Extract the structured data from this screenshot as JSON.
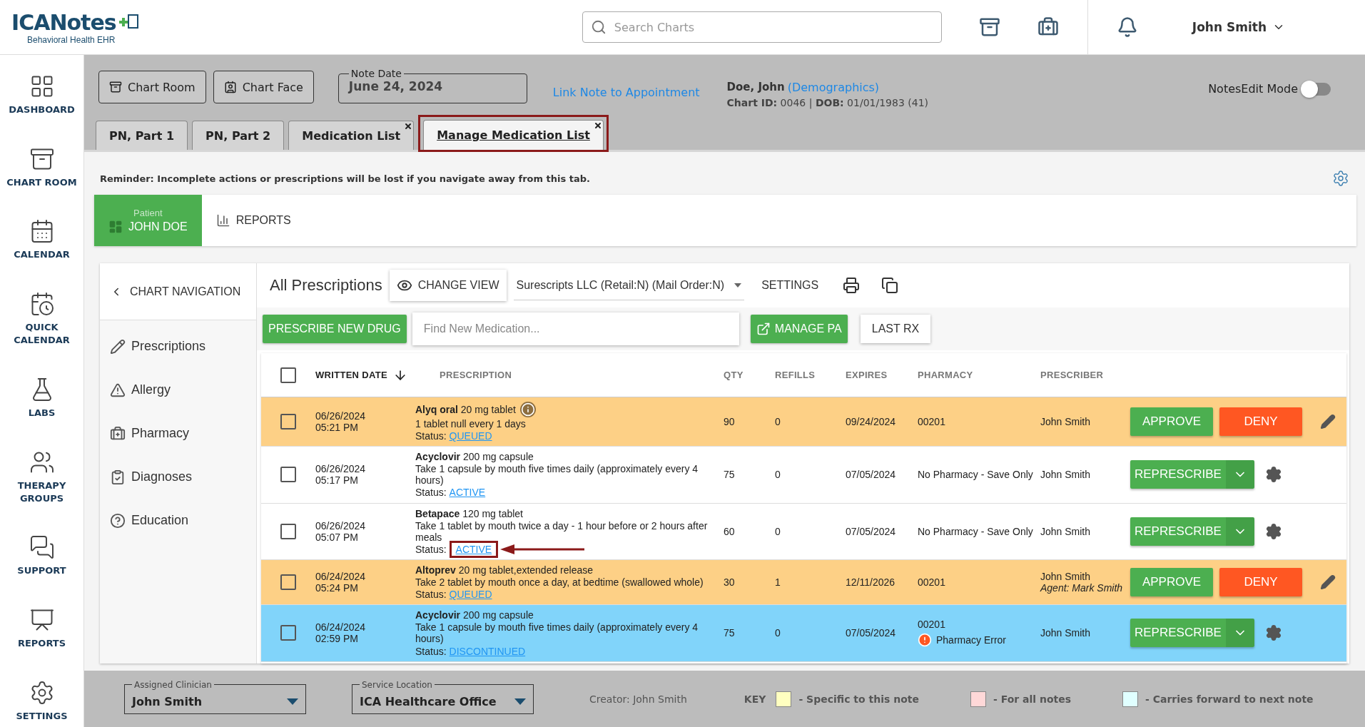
{
  "header": {
    "logo": {
      "name": "ICANotes",
      "tagline": "Behavioral Health EHR"
    },
    "search": {
      "placeholder": "Search Charts"
    },
    "user": "John Smith"
  },
  "sidebar": {
    "items": [
      {
        "label": "DASHBOARD"
      },
      {
        "label": "CHART ROOM"
      },
      {
        "label": "CALENDAR"
      },
      {
        "label": "QUICK CALENDAR"
      },
      {
        "label": "LABS"
      },
      {
        "label": "THERAPY GROUPS"
      },
      {
        "label": "SUPPORT"
      },
      {
        "label": "REPORTS"
      },
      {
        "label": "SETTINGS"
      }
    ]
  },
  "toolbar": {
    "buttons": [
      {
        "label": "Chart Room"
      },
      {
        "label": "Chart Face"
      }
    ],
    "note_date": {
      "label": "Note Date",
      "value": "June 24, 2024"
    },
    "link": "Link Note to Appointment",
    "patient": {
      "name": "Doe, John",
      "demographics": "(Demographics)",
      "details": "**Chart ID:** 0046 | **DOB:** 01/01/1983 (41)"
    },
    "edit_mode": {
      "label": "NotesEdit Mode",
      "on": false
    }
  },
  "tabs": [
    {
      "label": "PN, Part 1",
      "selected": false,
      "closable": false
    },
    {
      "label": "PN, Part 2",
      "selected": false,
      "closable": false
    },
    {
      "label": "Medication List",
      "selected": false,
      "closable": true
    },
    {
      "label": "Manage Medication List",
      "selected": true,
      "closable": true,
      "highlighted": true
    }
  ],
  "reminder": "Reminder: Incomplete actions or prescriptions will be lost if you navigate away from this tab.",
  "patient_bar": {
    "tabs": [
      {
        "caption": "Patient",
        "label": "JOHN DOE",
        "selected": true
      },
      {
        "label": "REPORTS",
        "selected": false
      }
    ]
  },
  "chart_navigation": {
    "title": "CHART NAVIGATION",
    "items": [
      {
        "label": "Prescriptions"
      },
      {
        "label": "Allergy"
      },
      {
        "label": "Pharmacy"
      },
      {
        "label": "Diagnoses"
      },
      {
        "label": "Education"
      }
    ]
  },
  "prescriptions": {
    "title": "All Prescriptions",
    "change_view": "CHANGE VIEW",
    "pharmacy_select": "Surescripts LLC (Retail:N) (Mail Order:N)",
    "settings": "SETTINGS",
    "prescribe_button": "PRESCRIBE NEW DRUG",
    "find": {
      "placeholder": "Find New Medication..."
    },
    "manage_pa": "MANAGE PA",
    "last_rx": "LAST RX",
    "columns": [
      "WRITTEN DATE",
      "PRESCRIPTION",
      "QTY",
      "REFILLS",
      "EXPIRES",
      "PHARMACY",
      "PRESCRIBER"
    ],
    "select_all_checked": false,
    "rows": [
      {
        "kind": "approve",
        "color": "#fdd086",
        "checked": false,
        "date": "06/26/2024",
        "time": "05:21 PM",
        "drug": "Alyq oral",
        "strength": "20 mg tablet",
        "info": true,
        "sig": "1 tablet null every 1 days",
        "status_label": "Status:",
        "status": "QUEUED",
        "qty": "90",
        "refills": "0",
        "expires": "09/24/2024",
        "pharmacy": "00201",
        "prescriber": "John Smith",
        "actions": [
          "APPROVE",
          "DENY"
        ]
      },
      {
        "kind": "represcribe",
        "color": "#ffffff",
        "checked": false,
        "date": "06/26/2024",
        "time": "05:17 PM",
        "drug": "Acyclovir",
        "strength": "200 mg capsule",
        "sig": "Take 1 capsule by mouth five times daily (approximately every 4 hours)",
        "status_label": "Status:",
        "status": "ACTIVE",
        "qty": "75",
        "refills": "0",
        "expires": "07/05/2024",
        "pharmacy": "No Pharmacy - Save Only",
        "prescriber": "John Smith",
        "actions": [
          "REPRESCRIBE"
        ]
      },
      {
        "kind": "represcribe",
        "color": "#ffffff",
        "checked": false,
        "date": "06/26/2024",
        "time": "05:07 PM",
        "drug": "Betapace",
        "strength": "120 mg tablet",
        "sig": "Take 1 tablet by mouth twice a day - 1 hour before or 2 hours after meals",
        "status_label": "Status:",
        "status": "ACTIVE",
        "highlighted": true,
        "qty": "60",
        "refills": "0",
        "expires": "07/05/2024",
        "pharmacy": "No Pharmacy - Save Only",
        "prescriber": "John Smith",
        "actions": [
          "REPRESCRIBE"
        ]
      },
      {
        "kind": "approve",
        "color": "#fdd086",
        "checked": false,
        "date": "06/24/2024",
        "time": "05:24 PM",
        "drug": "Altoprev",
        "strength": "20 mg tablet,extended release",
        "sig": "Take 2 tablet by mouth once a day, at bedtime (swallowed whole)",
        "status_label": "Status:",
        "status": "QUEUED",
        "qty": "30",
        "refills": "1",
        "expires": "12/11/2026",
        "pharmacy": "00201",
        "prescriber": "John Smith",
        "agent": "Agent: Mark Smith",
        "actions": [
          "APPROVE",
          "DENY"
        ]
      },
      {
        "kind": "represcribe",
        "color": "#81d4fa",
        "checked": false,
        "date": "06/24/2024",
        "time": "02:59 PM",
        "drug": "Acyclovir",
        "strength": "200 mg capsule",
        "sig": "Take 1 capsule by mouth five times daily (approximately every 4 hours)",
        "status_label": "Status:",
        "status": "DISCONTINUED",
        "qty": "75",
        "refills": "0",
        "expires": "07/05/2024",
        "pharmacy": "00201",
        "pharmacy_error": "Pharmacy Error",
        "prescriber": "John Smith",
        "actions": [
          "REPRESCRIBE"
        ]
      }
    ]
  },
  "footer": {
    "clinician": {
      "label": "Assigned Clinician",
      "value": "John Smith"
    },
    "location": {
      "label": "Service Location",
      "value": "ICA Healthcare Office"
    },
    "creator": "Creator: John Smith",
    "key_label": "KEY",
    "key": [
      {
        "color": "#ffffc0",
        "label": "- Specific to this note"
      },
      {
        "color": "#ffd8d8",
        "label": "- For all notes"
      },
      {
        "color": "#e0ffff",
        "label": "- Carries forward to next note"
      }
    ]
  }
}
